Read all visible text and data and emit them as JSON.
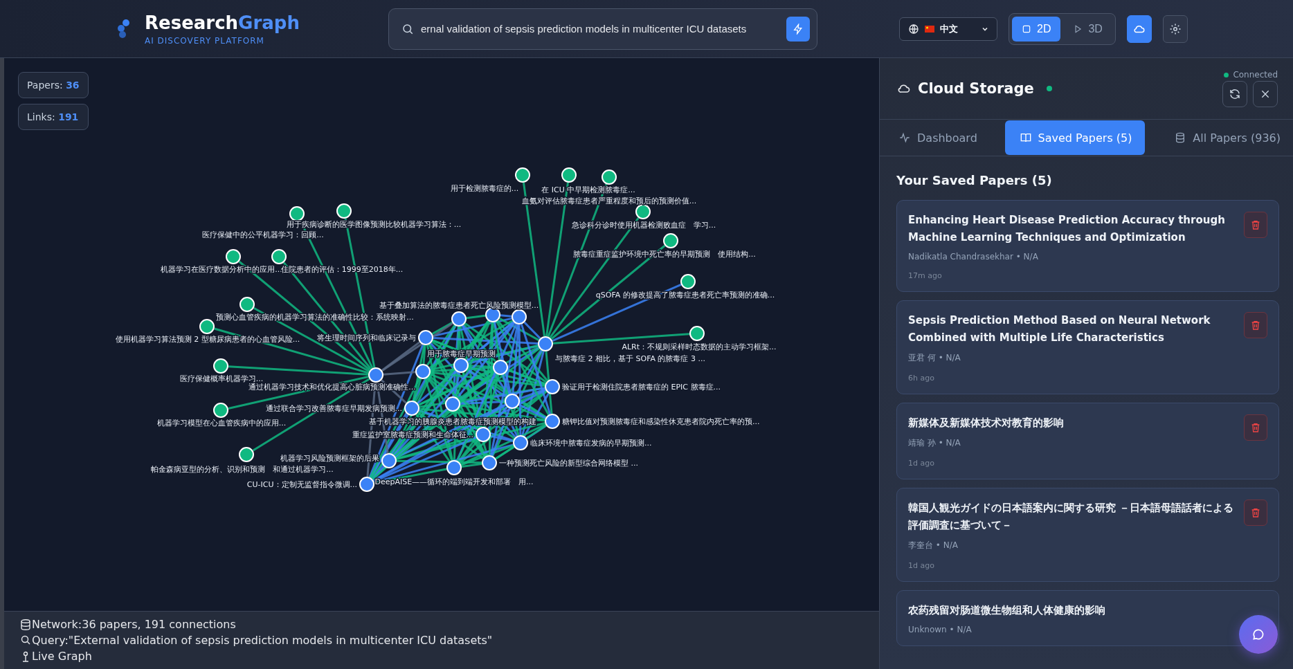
{
  "header": {
    "title_main": "Research",
    "title_accent": "Graph",
    "tagline": "AI DISCOVERY PLATFORM",
    "search_value": "ernal validation of sepsis prediction models in multicenter ICU datasets",
    "language": "中文",
    "view_modes": [
      {
        "label": "2D",
        "selected": true
      },
      {
        "label": "3D",
        "selected": false
      }
    ]
  },
  "stats": [
    {
      "label": "Papers:",
      "value": "36"
    },
    {
      "label": "Links:",
      "value": "191"
    }
  ],
  "graph": {
    "nodes": [
      {
        "label": "用于检测脓毒症的...",
        "color": "#10b981"
      },
      {
        "label": "在 ICU 中早期检测脓毒症...",
        "color": "#10b981"
      },
      {
        "label": "血氨对评估脓毒症患者严重程度和预后的预测价值...",
        "color": "#10b981"
      },
      {
        "label": "用于疾病诊断的医学图像预测比较机器学习算法：...",
        "color": "#10b981"
      },
      {
        "label": "急诊科分诊时使用机器检测败血症　学习...",
        "color": "#10b981"
      },
      {
        "label": "医疗保健中的公平机器学习：回顾...",
        "color": "#10b981"
      },
      {
        "label": "脓毒症重症监护环境中死亡率的早期预测　使用结构...",
        "color": "#10b981"
      },
      {
        "label": "机器学习在医疗数据分析中的应用...",
        "color": "#10b981"
      },
      {
        "label": "住院患者的评估：1999至2018年...",
        "color": "#10b981"
      },
      {
        "label": "qSOFA 的修改提高了脓毒症患者死亡率预测的准确...",
        "color": "#10b981"
      },
      {
        "label": "基于叠加算法的脓毒症患者死亡风险预测模型...",
        "color": "#3b82f6"
      },
      {
        "label": "预测心血管疾病的机器学习算法的准确性比较：系统映射...",
        "color": "#10b981"
      },
      {
        "label": "使用机器学习算法预测 2 型糖尿病患者的心血管风险...",
        "color": "#10b981"
      },
      {
        "label": "将生理时间序列和临床记录与",
        "color": "#3b82f6"
      },
      {
        "label": "ALRt：不规则采样时态数据的主动学习框架...",
        "color": "#10b981"
      },
      {
        "label": "用于脓毒症早期预测",
        "color": "#3b82f6"
      },
      {
        "label": "与脓毒症 2 相比，基于 SOFA 的脓毒症 3 ...",
        "color": "#3b82f6"
      },
      {
        "label": "医疗保健概率机器学习...",
        "color": "#10b981"
      },
      {
        "label": "通过机器学习技术和优化提高心脏病预测准确性...",
        "color": "#3b82f6"
      },
      {
        "label": "验证用于检测住院患者脓毒症的 EPIC 脓毒症...",
        "color": "#3b82f6"
      },
      {
        "label": "通过联合学习改善脓毒症早期发病预测...",
        "color": "#3b82f6"
      },
      {
        "label": "机器学习模型在心血管疾病中的应用...",
        "color": "#10b981"
      },
      {
        "label": "基于机器学习的胰腺炎患者脓毒症预测模型的构建",
        "color": "#3b82f6"
      },
      {
        "label": "糖钾比值对预测脓毒症和感染性休克患者院内死亡率的预...",
        "color": "#3b82f6"
      },
      {
        "label": "重症监护室脓毒症预测和生命体征...",
        "color": "#3b82f6"
      },
      {
        "label": "临床环境中脓毒症发病的早期预测...",
        "color": "#3b82f6"
      },
      {
        "label": "机器学习风险预测框架的后果",
        "color": "#3b82f6"
      },
      {
        "label": "一种预测死亡风险的新型综合网络模型 ...",
        "color": "#3b82f6"
      },
      {
        "label": "帕金森病亚型的分析、识别和预测　和通过机器学习...",
        "color": "#10b981"
      },
      {
        "label": "CU-ICU：定制无监督指令微调...",
        "color": "#3b82f6"
      },
      {
        "label": "DeepAISE——循环的端到端开发和部署　用...",
        "color": "#3b82f6"
      },
      {
        "color": "#3b82f6"
      },
      {
        "color": "#3b82f6"
      },
      {
        "color": "#3b82f6"
      },
      {
        "color": "#3b82f6"
      },
      {
        "color": "#3b82f6"
      }
    ]
  },
  "status": [
    {
      "kind": "network",
      "text": "Network:36 papers, 191 connections"
    },
    {
      "kind": "query",
      "text": "Query:\"External validation of sepsis prediction models in multicenter ICU datasets\""
    },
    {
      "kind": "live",
      "text": "Live Graph"
    }
  ],
  "panel": {
    "title": "Cloud Storage",
    "connection": "Connected",
    "tabs": [
      {
        "kind": "dashboard",
        "label": "Dashboard",
        "selected": false
      },
      {
        "kind": "saved",
        "label": "Saved Papers (5)",
        "selected": true
      },
      {
        "kind": "all",
        "label": "All Papers (936)",
        "selected": false
      }
    ],
    "heading": "Your Saved Papers (5)",
    "papers": [
      {
        "title": "Enhancing Heart Disease Prediction Accuracy through Machine Learning Techniques and Optimization",
        "byline": "Nadikatla Chandrasekhar • N/A",
        "time": "17m ago"
      },
      {
        "title": "Sepsis Prediction Method Based on Neural Network Combined with Multiple Life Characteristics",
        "byline": "亚君 何 • N/A",
        "time": "6h ago"
      },
      {
        "title": "新媒体及新媒体技术对教育的影响",
        "byline": "靖瑜 孙 • N/A",
        "time": "1d ago"
      },
      {
        "title": "韓国人観光ガイドの日本語案内に関する研究 －日本語母語話者による評価調査に基づいて－",
        "byline": "李奎台 • N/A",
        "time": "1d ago"
      },
      {
        "title": "农药残留对肠道微生物组和人体健康的影响",
        "byline": "Unknown • N/A"
      }
    ]
  }
}
